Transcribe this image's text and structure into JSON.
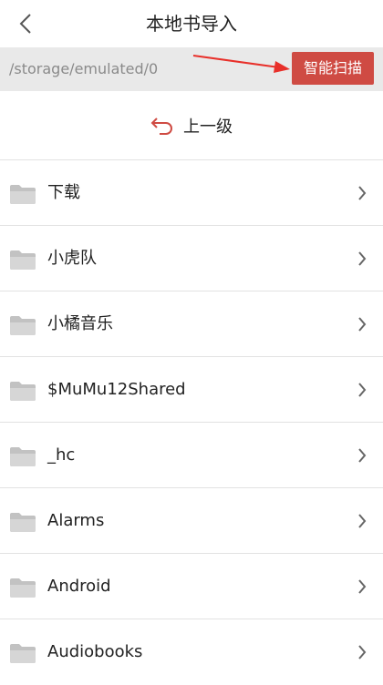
{
  "header": {
    "title": "本地书导入",
    "back_icon": "chevron-left-icon"
  },
  "pathbar": {
    "path": "/storage/emulated/0",
    "scan_label": "智能扫描"
  },
  "up": {
    "label": "上一级",
    "icon": "return-arrow-icon"
  },
  "folders": [
    {
      "name": "下载"
    },
    {
      "name": "小虎队"
    },
    {
      "name": "小橘音乐"
    },
    {
      "name": "$MuMu12Shared"
    },
    {
      "name": "_hc"
    },
    {
      "name": "Alarms"
    },
    {
      "name": "Android"
    },
    {
      "name": "Audiobooks"
    }
  ],
  "colors": {
    "accent": "#cf4b43",
    "annotation": "#e8302a",
    "folder": "#bdbdbd"
  }
}
